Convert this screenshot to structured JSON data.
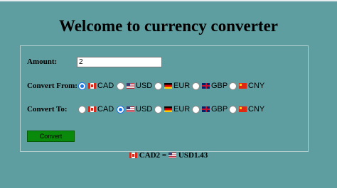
{
  "title": "Welcome to currency converter",
  "amount": {
    "label": "Amount:",
    "value": "2"
  },
  "convert_from": {
    "label": "Convert From:",
    "selected": "CAD",
    "options": [
      {
        "code": "CAD",
        "label": "CAD"
      },
      {
        "code": "USD",
        "label": "USD"
      },
      {
        "code": "EUR",
        "label": "EUR"
      },
      {
        "code": "GBP",
        "label": "GBP"
      },
      {
        "code": "CNY",
        "label": "CNY"
      }
    ]
  },
  "convert_to": {
    "label": "Convert To:",
    "selected": "USD",
    "options": [
      {
        "code": "CAD",
        "label": "CAD"
      },
      {
        "code": "USD",
        "label": "USD"
      },
      {
        "code": "EUR",
        "label": "EUR"
      },
      {
        "code": "GBP",
        "label": "GBP"
      },
      {
        "code": "CNY",
        "label": "CNY"
      }
    ]
  },
  "convert_button": "Convert",
  "result": {
    "from_code": "CAD",
    "from_amount": "2",
    "equals": " = ",
    "to_code": "USD",
    "to_amount": "1.43"
  }
}
